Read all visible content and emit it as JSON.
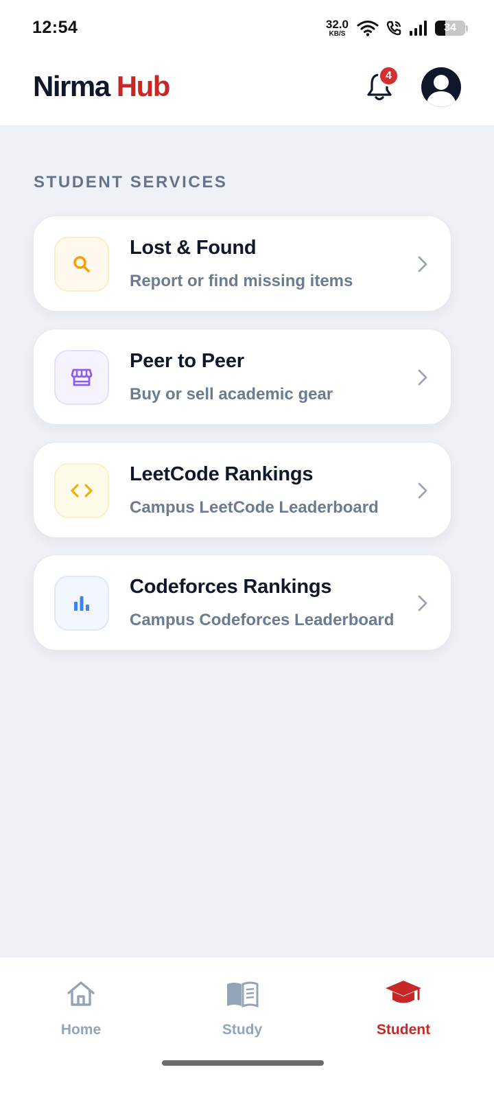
{
  "status_bar": {
    "time": "12:54",
    "net_speed": "32.0",
    "net_unit": "KB/S",
    "battery": "34"
  },
  "header": {
    "brand_part1": "Nirma",
    "brand_part2": "Hub",
    "notification_count": "4"
  },
  "section": {
    "title": "STUDENT SERVICES"
  },
  "services": [
    {
      "title": "Lost & Found",
      "subtitle": "Report or find missing items",
      "icon": "search-icon",
      "color": "#f59e0b"
    },
    {
      "title": "Peer to Peer",
      "subtitle": "Buy or sell academic gear",
      "icon": "store-icon",
      "color": "#8b5cf6"
    },
    {
      "title": "LeetCode Rankings",
      "subtitle": "Campus LeetCode Leaderboard",
      "icon": "code-icon",
      "color": "#eab308"
    },
    {
      "title": "Codeforces Rankings",
      "subtitle": "Campus Codeforces Leaderboard",
      "icon": "bar-chart-icon",
      "color": "#3b82f6"
    }
  ],
  "bottom_nav": {
    "items": [
      {
        "label": "Home",
        "icon": "home-icon",
        "active": false
      },
      {
        "label": "Study",
        "icon": "book-icon",
        "active": false
      },
      {
        "label": "Student",
        "icon": "graduation-cap-icon",
        "active": true
      }
    ]
  },
  "colors": {
    "brand_accent": "#c62828",
    "active_nav": "#c62828",
    "muted_nav": "#94a3b8"
  }
}
